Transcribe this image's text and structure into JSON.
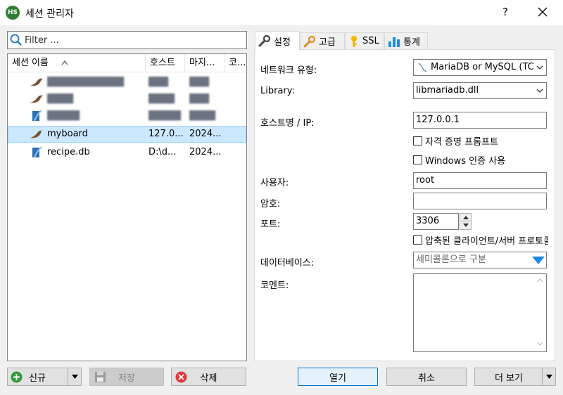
{
  "window": {
    "app_icon_text": "HS",
    "title": "세션 관리자",
    "help": "?"
  },
  "filter": {
    "placeholder": "Filter ..."
  },
  "tree": {
    "columns": [
      "세션 이름",
      "호스트",
      "마지...",
      "코..."
    ],
    "rows": [
      {
        "name": "████████████",
        "host": "███",
        "date": "███",
        "redacted": true,
        "icon": "mariadb-icon"
      },
      {
        "name": "████",
        "host": "████",
        "date": "███",
        "redacted": true,
        "icon": "mariadb-icon"
      },
      {
        "name": "█████",
        "host": "█████",
        "date": "████",
        "redacted": true,
        "icon": "sqlite-icon"
      },
      {
        "name": "myboard",
        "host": "127.0...",
        "date": "2024...",
        "selected": true,
        "icon": "mariadb-icon"
      },
      {
        "name": "recipe.db",
        "host": "D:\\d...",
        "date": "2024...",
        "icon": "sqlite-icon"
      }
    ]
  },
  "buttons": {
    "new": "신규",
    "save": "저장",
    "delete": "삭제",
    "open": "열기",
    "cancel": "취소",
    "more": "더 보기"
  },
  "tabs": {
    "settings": "설정",
    "advanced": "고급",
    "ssl": "SSL",
    "stats": "통계"
  },
  "form": {
    "network_type_label": "네트워크 유형:",
    "network_type_value": "MariaDB or MySQL (TC",
    "library_label": "Library:",
    "library_value": "libmariadb.dll",
    "host_label": "호스트명 / IP:",
    "host_value": "127.0.0.1",
    "prompt_credentials": "자격 증명 프롬프트",
    "windows_auth": "Windows 인증 사용",
    "user_label": "사용자:",
    "user_value": "root",
    "password_label": "암호:",
    "password_value": "",
    "port_label": "포트:",
    "port_value": "3306",
    "compressed_protocol": "압축된 클라이언트/서버 프로토콜",
    "database_label": "데이터베이스:",
    "database_placeholder": "세미콜론으로 구분",
    "comment_label": "코멘트:",
    "comment_value": ""
  },
  "colors": {
    "accent": "#0078d7",
    "selected_row": "#cce8ff",
    "new_icon": "#2e9b3a",
    "delete_icon": "#e03b3b",
    "database_dropdown": "#1e88e5"
  }
}
